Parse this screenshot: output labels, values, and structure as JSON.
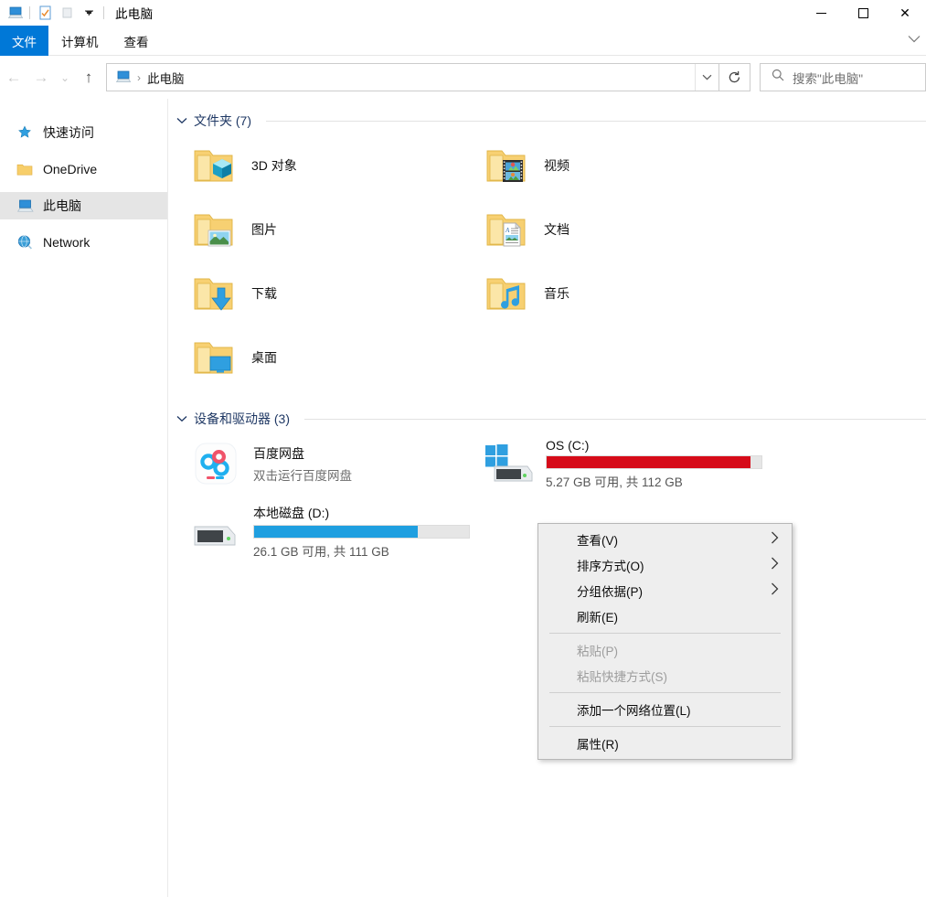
{
  "window": {
    "title": "此电脑",
    "quick_access_icons": [
      "computer-icon",
      "properties-icon",
      "new-folder-icon",
      "customize-dropdown-icon"
    ],
    "controls": {
      "minimize": "—",
      "maximize": "▢",
      "close": "✕"
    }
  },
  "ribbon": {
    "tabs": [
      {
        "label": "文件",
        "active": true
      },
      {
        "label": "计算机",
        "active": false
      },
      {
        "label": "查看",
        "active": false
      }
    ],
    "expand_icon": "chevron-down-icon"
  },
  "navbar": {
    "back_icon": "←",
    "forward_icon": "→",
    "recent_icon": "⌄",
    "up_icon": "↑",
    "breadcrumb": {
      "icon": "computer-icon",
      "separator": "›",
      "text": "此电脑"
    },
    "address_dropdown_icon": "⌄",
    "refresh_icon": "↻",
    "search": {
      "placeholder": "搜索\"此电脑\"",
      "icon": "search-icon"
    }
  },
  "sidebar": {
    "items": [
      {
        "label": "快速访问",
        "icon": "pin-star-icon",
        "selected": false
      },
      {
        "label": "OneDrive",
        "icon": "folder-icon",
        "selected": false
      },
      {
        "label": "此电脑",
        "icon": "computer-icon",
        "selected": true
      },
      {
        "label": "Network",
        "icon": "network-globe-icon",
        "selected": false
      }
    ]
  },
  "groups": [
    {
      "title": "文件夹 (7)",
      "chevron": "⌄",
      "folders": [
        {
          "label": "3D 对象",
          "icon": "folder-3d-icon"
        },
        {
          "label": "视频",
          "icon": "folder-videos-icon"
        },
        {
          "label": "图片",
          "icon": "folder-pictures-icon"
        },
        {
          "label": "文档",
          "icon": "folder-documents-icon"
        },
        {
          "label": "下载",
          "icon": "folder-downloads-icon"
        },
        {
          "label": "音乐",
          "icon": "folder-music-icon"
        },
        {
          "label": "桌面",
          "icon": "folder-desktop-icon"
        }
      ]
    },
    {
      "title": "设备和驱动器 (3)",
      "chevron": "⌄"
    }
  ],
  "devices": [
    {
      "name": "百度网盘",
      "subtitle": "双击运行百度网盘",
      "icon": "baidu-netdisk-icon",
      "selected": true,
      "has_bar": false
    },
    {
      "name": "OS (C:)",
      "icon": "windows-drive-icon",
      "selected": false,
      "has_bar": true,
      "bar_color": "#d60b19",
      "used_percent": 95,
      "free_text": "5.27 GB 可用, 共 112 GB"
    },
    {
      "name": "本地磁盘 (D:)",
      "icon": "hard-drive-icon",
      "selected": false,
      "has_bar": true,
      "bar_color": "#1f9fe0",
      "used_percent": 76,
      "free_text": "26.1 GB 可用, 共 111 GB"
    }
  ],
  "context_menu": {
    "items": [
      {
        "label": "查看(V)",
        "submenu": true,
        "disabled": false
      },
      {
        "label": "排序方式(O)",
        "submenu": true,
        "disabled": false
      },
      {
        "label": "分组依据(P)",
        "submenu": true,
        "disabled": false
      },
      {
        "label": "刷新(E)",
        "submenu": false,
        "disabled": false
      },
      {
        "separator": true
      },
      {
        "label": "粘贴(P)",
        "submenu": false,
        "disabled": true
      },
      {
        "label": "粘贴快捷方式(S)",
        "submenu": false,
        "disabled": true
      },
      {
        "separator": true
      },
      {
        "label": "添加一个网络位置(L)",
        "submenu": false,
        "disabled": false
      },
      {
        "separator": true
      },
      {
        "label": "属性(R)",
        "submenu": false,
        "disabled": false
      }
    ],
    "submenu_arrow": "›"
  },
  "colors": {
    "accent": "#0078d7",
    "group_header": "#1f3864",
    "drive_full": "#d60b19",
    "drive_ok": "#1f9fe0"
  }
}
